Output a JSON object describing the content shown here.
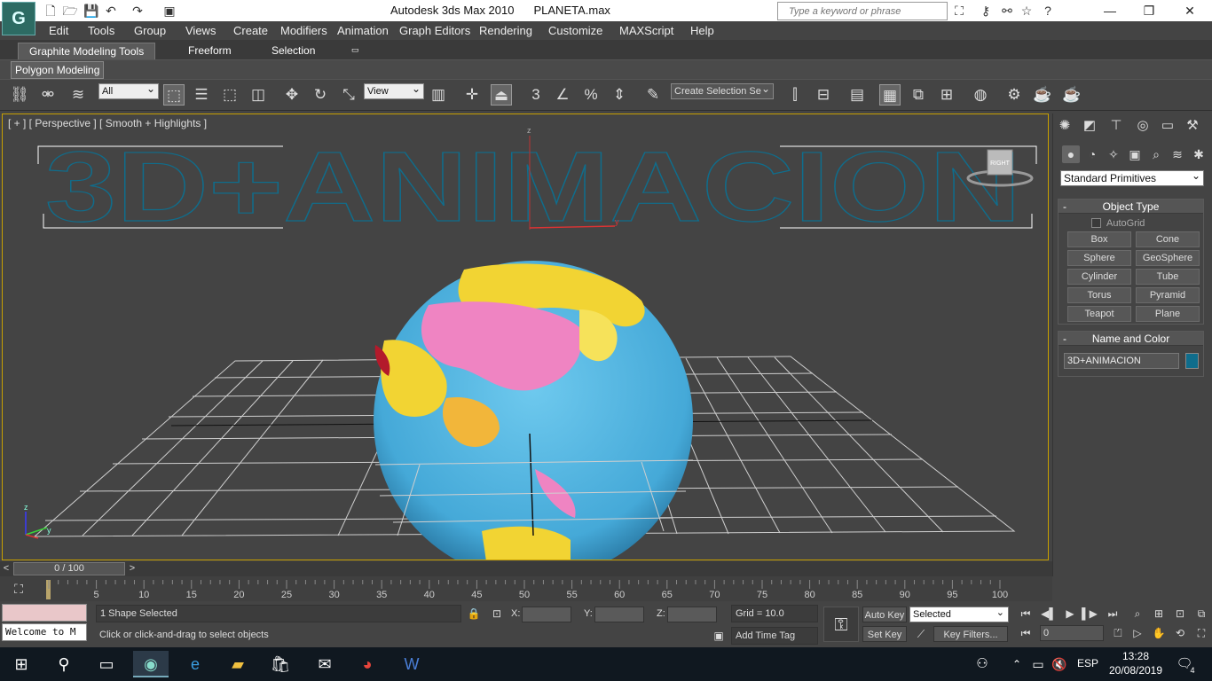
{
  "titlebar": {
    "app": "Autodesk 3ds Max  2010",
    "file": "PLANETA.max",
    "search_placeholder": "Type a keyword or phrase",
    "logo_text": "G"
  },
  "menu": [
    "Edit",
    "Tools",
    "Group",
    "Views",
    "Create",
    "Modifiers",
    "Animation",
    "Graph Editors",
    "Rendering",
    "Customize",
    "MAXScript",
    "Help"
  ],
  "ribbon": {
    "tabs": [
      "Graphite Modeling Tools",
      "Freeform",
      "Selection"
    ],
    "panel_tab": "Polygon Modeling"
  },
  "toolbar": {
    "filter_select": "All",
    "ref_coord_select": "View",
    "named_selection": "Create Selection Se",
    "snap_label": "3"
  },
  "viewport": {
    "label": "[ + ] [ Perspective ] [ Smooth + Highlights ]",
    "text_object": "3D+ANIMACION",
    "viewcube_label": "RIGHT",
    "axis_z": "z",
    "axis_y": "y"
  },
  "command_panel": {
    "primitives_select": "Standard Primitives",
    "object_type_title": "Object Type",
    "autogrid_label": "AutoGrid",
    "buttons": [
      "Box",
      "Cone",
      "Sphere",
      "GeoSphere",
      "Cylinder",
      "Tube",
      "Torus",
      "Pyramid",
      "Teapot",
      "Plane"
    ],
    "name_color_title": "Name and Color",
    "object_name": "3D+ANIMACION",
    "object_color": "#0f6d8c"
  },
  "timeline": {
    "frame_display": "0 / 100",
    "ticks": [
      "5",
      "10",
      "15",
      "20",
      "25",
      "30",
      "35",
      "40",
      "45",
      "50",
      "55",
      "60",
      "65",
      "70",
      "75",
      "80",
      "85",
      "90",
      "95",
      "100"
    ]
  },
  "status": {
    "maxscript_text": "Welcome to M",
    "selection_info": "1 Shape Selected",
    "prompt": "Click or click-and-drag to select objects",
    "x_label": "X:",
    "y_label": "Y:",
    "z_label": "Z:",
    "grid": "Grid = 10.0",
    "add_time_tag": "Add Time Tag",
    "auto_key": "Auto Key",
    "set_key": "Set Key",
    "selected_dropdown": "Selected",
    "key_filters": "Key Filters...",
    "frame_field": "0"
  },
  "taskbar": {
    "language": "ESP",
    "time": "13:28",
    "date": "20/08/2019",
    "notifications": "4"
  }
}
